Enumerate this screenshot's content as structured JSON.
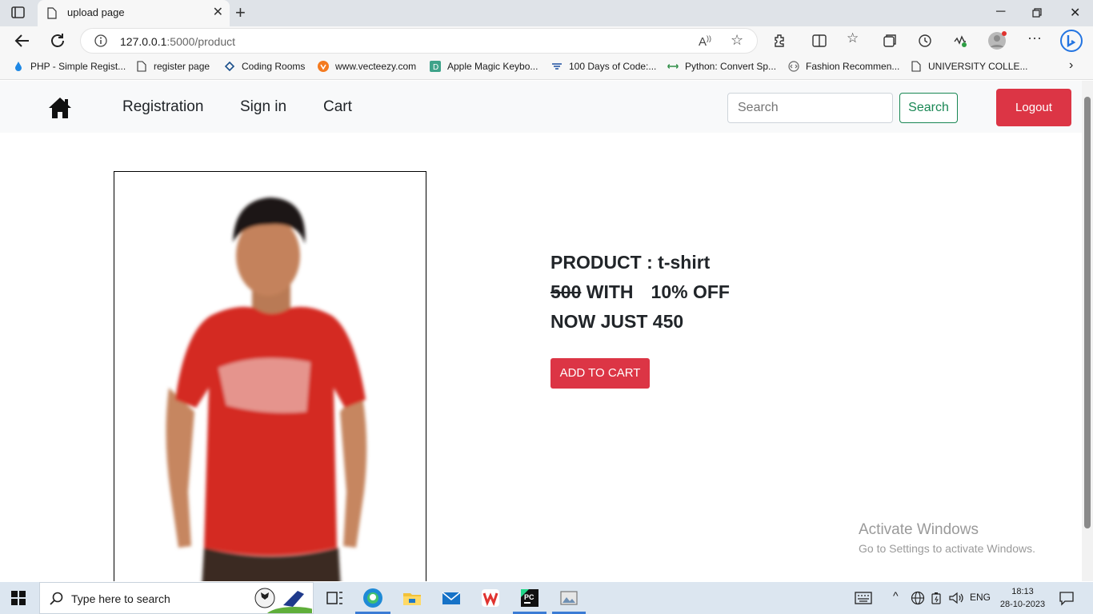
{
  "browser": {
    "tab_title": "upload page",
    "url_host": "127.0.0.1",
    "url_path": ":5000/product",
    "bookmarks": [
      "PHP - Simple Regist...",
      "register page",
      "Coding Rooms",
      "www.vecteezy.com",
      "Apple Magic Keybo...",
      "100 Days of Code:...",
      "Python: Convert Sp...",
      "Fashion Recommen...",
      "UNIVERSITY COLLE..."
    ]
  },
  "navbar": {
    "links": [
      "Registration",
      "Sign in",
      "Cart"
    ],
    "search_placeholder": "Search",
    "search_button": "Search",
    "logout_button": "Logout"
  },
  "product": {
    "name_line": "PRODUCT : t-shirt",
    "original_price": "500",
    "with_text": "WITH",
    "discount_text": "10% OFF",
    "final_line": "NOW JUST 450",
    "add_to_cart": "ADD TO CART"
  },
  "watermark": {
    "title": "Activate Windows",
    "subtitle": "Go to Settings to activate Windows."
  },
  "taskbar": {
    "search_placeholder": "Type here to search",
    "language": "ENG",
    "time": "18:13",
    "date": "28-10-2023"
  },
  "colors": {
    "danger": "#dc3545",
    "success": "#198754",
    "shirt": "#d42a22"
  }
}
